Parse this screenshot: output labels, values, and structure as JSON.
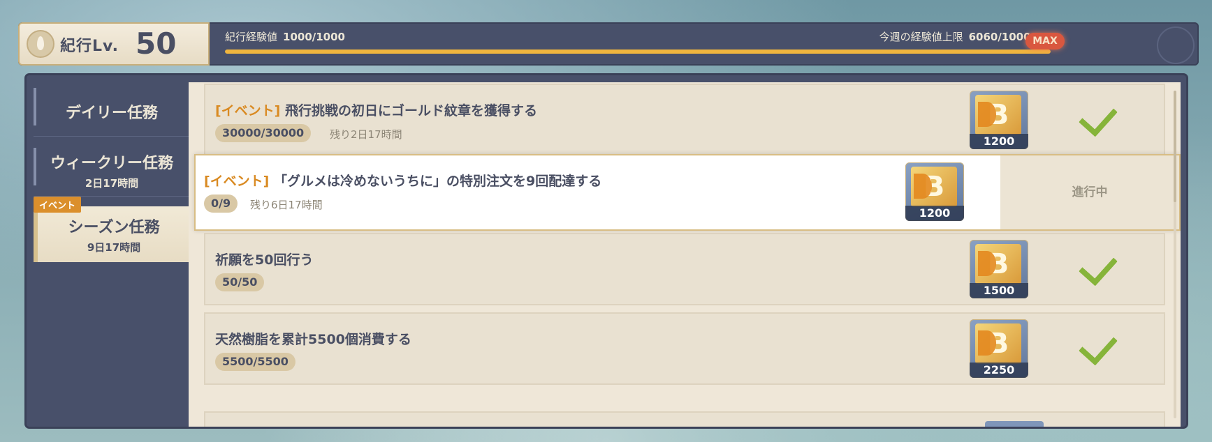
{
  "header": {
    "lv_label": "紀行Lv.",
    "lv_value": "50",
    "exp_label": "紀行経験値",
    "exp_value": "1000/1000",
    "exp_progress": 1.0,
    "weekly_label": "今週の経験値上限",
    "weekly_value": "6060/10000",
    "max_badge": "MAX"
  },
  "sidebar": {
    "items": [
      {
        "label": "デイリー任務"
      },
      {
        "label": "ウィークリー任務",
        "time": "2日17時間"
      },
      {
        "label": "シーズン任務",
        "time": "9日17時間",
        "tag": "イベント",
        "selected": true
      }
    ]
  },
  "tasks": [
    {
      "tag": "[イベント]",
      "title": "飛行挑戦の初日にゴールド紋章を獲得する",
      "progress": "30000/30000",
      "remaining": "残り2日17時間",
      "reward_icon": "bp-exp-icon",
      "reward_qty": "1200",
      "status": "completed"
    },
    {
      "tag": "[イベント]",
      "title": "「グルメは冷めないうちに」の特別注文を9回配達する",
      "progress": "0/9",
      "remaining": "残り6日17時間",
      "reward_icon": "bp-exp-icon",
      "reward_qty": "1200",
      "status": "進行中"
    },
    {
      "title": "祈願を50回行う",
      "progress": "50/50",
      "reward_icon": "bp-exp-icon",
      "reward_qty": "1500",
      "status": "completed"
    },
    {
      "title": "天然樹脂を累計5500個消費する",
      "progress": "5500/5500",
      "reward_icon": "bp-exp-icon",
      "reward_qty": "2250",
      "status": "completed"
    }
  ],
  "colors": {
    "accent": "#f0b53e",
    "tag": "#d98a22",
    "check": "#86b43a",
    "max_badge": "#d9573f"
  }
}
